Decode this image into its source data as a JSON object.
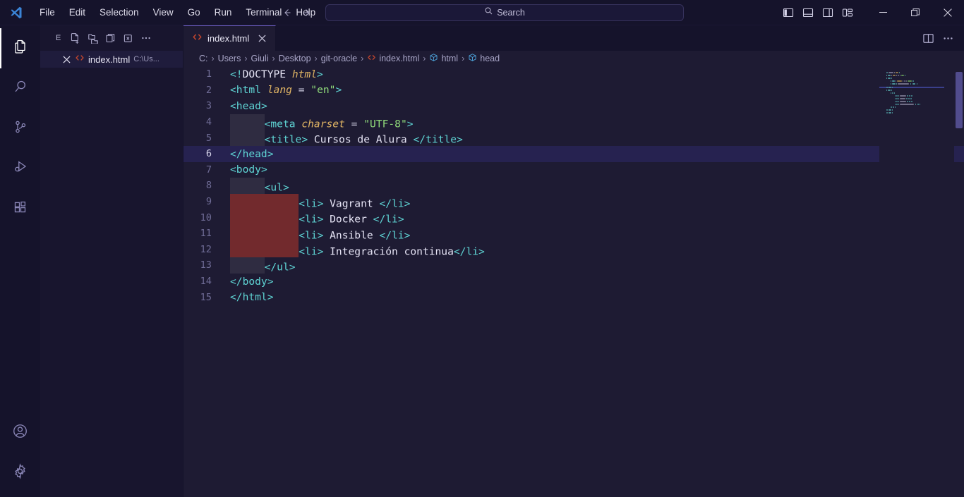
{
  "window": {
    "app_icon": "vscode-logo-icon",
    "menu": [
      "File",
      "Edit",
      "Selection",
      "View",
      "Go",
      "Run",
      "Terminal",
      "Help"
    ],
    "search_placeholder": "Search",
    "nav_back": "back-arrow-icon",
    "nav_forward": "forward-arrow-icon",
    "layout_buttons": [
      "toggle-primary-sidebar-icon",
      "toggle-panel-icon",
      "toggle-secondary-sidebar-icon",
      "customize-layout-icon"
    ],
    "minimize": "minimize-icon",
    "restore": "restore-icon",
    "close": "close-icon"
  },
  "activitybar": {
    "items": [
      {
        "name": "explorer",
        "icon": "files-icon",
        "active": true
      },
      {
        "name": "search",
        "icon": "search-icon",
        "active": false
      },
      {
        "name": "source-control",
        "icon": "source-control-icon",
        "active": false
      },
      {
        "name": "run-and-debug",
        "icon": "run-debug-icon",
        "active": false
      },
      {
        "name": "extensions",
        "icon": "extensions-icon",
        "active": false
      }
    ],
    "bottom": [
      {
        "name": "accounts",
        "icon": "account-icon"
      },
      {
        "name": "manage-settings",
        "icon": "gear-icon"
      }
    ]
  },
  "sidebar": {
    "title": "E",
    "title_full": "EXPLORER",
    "actions": [
      "new-file-icon",
      "new-folder-icon",
      "refresh-explorer-icon",
      "collapse-folders-icon",
      "more-actions-icon"
    ],
    "open_editor": {
      "close": "close-icon",
      "file_icon": "html-file-icon",
      "name": "index.html",
      "path": "C:\\Us..."
    }
  },
  "tabs": [
    {
      "file_icon": "html-file-icon",
      "label": "index.html",
      "close": "close-icon",
      "active": true
    }
  ],
  "tabbar_actions": [
    "split-editor-right-icon",
    "more-actions-icon"
  ],
  "breadcrumbs": [
    {
      "label": "C:",
      "icon": ""
    },
    {
      "label": "Users",
      "icon": ""
    },
    {
      "label": "Giuli",
      "icon": ""
    },
    {
      "label": "Desktop",
      "icon": ""
    },
    {
      "label": "git-oracle",
      "icon": ""
    },
    {
      "label": "index.html",
      "icon": "html-file-icon"
    },
    {
      "label": "html",
      "icon": "symbol-field-icon"
    },
    {
      "label": "head",
      "icon": "symbol-field-icon"
    }
  ],
  "breadcrumb_separator": "›",
  "editor": {
    "filename": "index.html",
    "language": "html",
    "current_line": 6,
    "lines": [
      {
        "n": 1,
        "indent": [],
        "tokens": [
          [
            "angle",
            "<!"
          ],
          [
            "doct",
            "DOCTYPE"
          ],
          [
            "txt",
            " "
          ],
          [
            "attr",
            "html"
          ],
          [
            "angle",
            ">"
          ]
        ]
      },
      {
        "n": 2,
        "indent": [],
        "tokens": [
          [
            "angle",
            "<"
          ],
          [
            "tag",
            "html"
          ],
          [
            "txt",
            " "
          ],
          [
            "attr",
            "lang"
          ],
          [
            "txt",
            " "
          ],
          [
            "eq",
            "="
          ],
          [
            "txt",
            " "
          ],
          [
            "str",
            "\"en\""
          ],
          [
            "angle",
            ">"
          ]
        ]
      },
      {
        "n": 3,
        "indent": [],
        "tokens": [
          [
            "angle",
            "<"
          ],
          [
            "tag",
            "head"
          ],
          [
            "angle",
            ">"
          ]
        ]
      },
      {
        "n": 4,
        "indent": [
          "g"
        ],
        "tokens": [
          [
            "angle",
            "<"
          ],
          [
            "tag",
            "meta"
          ],
          [
            "txt",
            " "
          ],
          [
            "attr",
            "charset"
          ],
          [
            "txt",
            " "
          ],
          [
            "eq",
            "="
          ],
          [
            "txt",
            " "
          ],
          [
            "str",
            "\"UTF-8\""
          ],
          [
            "angle",
            ">"
          ]
        ]
      },
      {
        "n": 5,
        "indent": [
          "g"
        ],
        "tokens": [
          [
            "angle",
            "<"
          ],
          [
            "tag",
            "title"
          ],
          [
            "angle",
            ">"
          ],
          [
            "txt",
            " Cursos de Alura "
          ],
          [
            "angle",
            "</"
          ],
          [
            "tag",
            "title"
          ],
          [
            "angle",
            ">"
          ]
        ]
      },
      {
        "n": 6,
        "indent": [],
        "tokens": [
          [
            "angle",
            "</"
          ],
          [
            "tag",
            "head"
          ],
          [
            "angle",
            ">"
          ]
        ]
      },
      {
        "n": 7,
        "indent": [],
        "tokens": [
          [
            "angle",
            "<"
          ],
          [
            "tag",
            "body"
          ],
          [
            "angle",
            ">"
          ]
        ]
      },
      {
        "n": 8,
        "indent": [
          "g"
        ],
        "tokens": [
          [
            "angle",
            "<"
          ],
          [
            "tag",
            "ul"
          ],
          [
            "angle",
            ">"
          ]
        ]
      },
      {
        "n": 9,
        "indent": [
          "r",
          "r"
        ],
        "tokens": [
          [
            "angle",
            "<"
          ],
          [
            "tag",
            "li"
          ],
          [
            "angle",
            ">"
          ],
          [
            "txt",
            " Vagrant "
          ],
          [
            "angle",
            "</"
          ],
          [
            "tag",
            "li"
          ],
          [
            "angle",
            ">"
          ]
        ]
      },
      {
        "n": 10,
        "indent": [
          "r",
          "r"
        ],
        "tokens": [
          [
            "angle",
            "<"
          ],
          [
            "tag",
            "li"
          ],
          [
            "angle",
            ">"
          ],
          [
            "txt",
            " Docker "
          ],
          [
            "angle",
            "</"
          ],
          [
            "tag",
            "li"
          ],
          [
            "angle",
            ">"
          ]
        ]
      },
      {
        "n": 11,
        "indent": [
          "r",
          "r"
        ],
        "tokens": [
          [
            "angle",
            "<"
          ],
          [
            "tag",
            "li"
          ],
          [
            "angle",
            ">"
          ],
          [
            "txt",
            " Ansible "
          ],
          [
            "angle",
            "</"
          ],
          [
            "tag",
            "li"
          ],
          [
            "angle",
            ">"
          ]
        ]
      },
      {
        "n": 12,
        "indent": [
          "r",
          "r"
        ],
        "tokens": [
          [
            "angle",
            "<"
          ],
          [
            "tag",
            "li"
          ],
          [
            "angle",
            ">"
          ],
          [
            "txt",
            " Integración continua"
          ],
          [
            "angle",
            "</"
          ],
          [
            "tag",
            "li"
          ],
          [
            "angle",
            ">"
          ]
        ]
      },
      {
        "n": 13,
        "indent": [
          "g"
        ],
        "tokens": [
          [
            "angle",
            "</"
          ],
          [
            "tag",
            "ul"
          ],
          [
            "angle",
            ">"
          ]
        ]
      },
      {
        "n": 14,
        "indent": [],
        "tokens": [
          [
            "angle",
            "</"
          ],
          [
            "tag",
            "body"
          ],
          [
            "angle",
            ">"
          ]
        ]
      },
      {
        "n": 15,
        "indent": [],
        "tokens": [
          [
            "angle",
            "</"
          ],
          [
            "tag",
            "html"
          ],
          [
            "angle",
            ">"
          ]
        ]
      }
    ]
  },
  "colors": {
    "titlebar_bg": "#15132b",
    "activitybar_bg": "#15132b",
    "sidebar_bg": "#18152e",
    "editor_bg": "#1e1b33",
    "current_line_bg": "#262250",
    "tab_top_border": "#6e5ec4",
    "indent_level1": "#2f2c41",
    "indent_level2": "#722a2d",
    "tag_color": "#5fd4d4",
    "attr_color": "#e0b464",
    "string_color": "#8fd97a",
    "text_color": "#e6e4f5",
    "line_number": "#6f6c96",
    "scrollbar_thumb": "#5b559e",
    "html_icon": "#c1452e"
  }
}
